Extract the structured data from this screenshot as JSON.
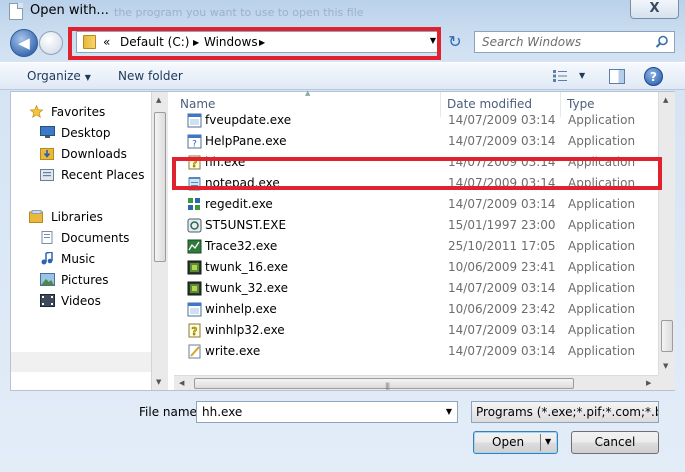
{
  "window": {
    "title": "Open with...",
    "title_ghost": "the program you want to use to open this file"
  },
  "address": {
    "prefix": "«",
    "crumbs": [
      "Default (C:)",
      "Windows"
    ]
  },
  "search": {
    "placeholder": "Search Windows"
  },
  "toolbar": {
    "organize": "Organize",
    "new_folder": "New folder"
  },
  "nav": {
    "favorites": "Favorites",
    "favorite_items": [
      "Desktop",
      "Downloads",
      "Recent Places"
    ],
    "libraries": "Libraries",
    "library_items": [
      "Documents",
      "Music",
      "Pictures",
      "Videos"
    ]
  },
  "columns": {
    "name": "Name",
    "date": "Date modified",
    "type": "Type"
  },
  "files": [
    {
      "name": "fveupdate.exe",
      "date": "14/07/2009 03:14",
      "type": "Application",
      "icon": "app-window-icon"
    },
    {
      "name": "HelpPane.exe",
      "date": "14/07/2009 03:14",
      "type": "Application",
      "icon": "help-pane-icon"
    },
    {
      "name": "hh.exe",
      "date": "14/07/2009 03:14",
      "type": "Application",
      "icon": "help-file-icon"
    },
    {
      "name": "notepad.exe",
      "date": "14/07/2009 03:14",
      "type": "Application",
      "icon": "notepad-icon"
    },
    {
      "name": "regedit.exe",
      "date": "14/07/2009 03:14",
      "type": "Application",
      "icon": "regedit-icon"
    },
    {
      "name": "ST5UNST.EXE",
      "date": "15/01/1997 23:00",
      "type": "Application",
      "icon": "uninstall-icon"
    },
    {
      "name": "Trace32.exe",
      "date": "25/10/2011 17:05",
      "type": "Application",
      "icon": "trace-icon"
    },
    {
      "name": "twunk_16.exe",
      "date": "10/06/2009 23:41",
      "type": "Application",
      "icon": "twain-icon"
    },
    {
      "name": "twunk_32.exe",
      "date": "14/07/2009 03:14",
      "type": "Application",
      "icon": "twain-icon"
    },
    {
      "name": "winhelp.exe",
      "date": "10/06/2009 23:42",
      "type": "Application",
      "icon": "app-window-icon"
    },
    {
      "name": "winhlp32.exe",
      "date": "14/07/2009 03:14",
      "type": "Application",
      "icon": "help-file-icon"
    },
    {
      "name": "write.exe",
      "date": "14/07/2009 03:14",
      "type": "Application",
      "icon": "write-icon"
    }
  ],
  "filename": {
    "label": "File name:",
    "value": "hh.exe"
  },
  "filter": {
    "value": "Programs (*.exe;*.pif;*.com;*.ba"
  },
  "buttons": {
    "open": "Open",
    "cancel": "Cancel",
    "close": "X"
  },
  "colors": {
    "highlight": "#e0212e",
    "accent": "#3c7fb1"
  }
}
